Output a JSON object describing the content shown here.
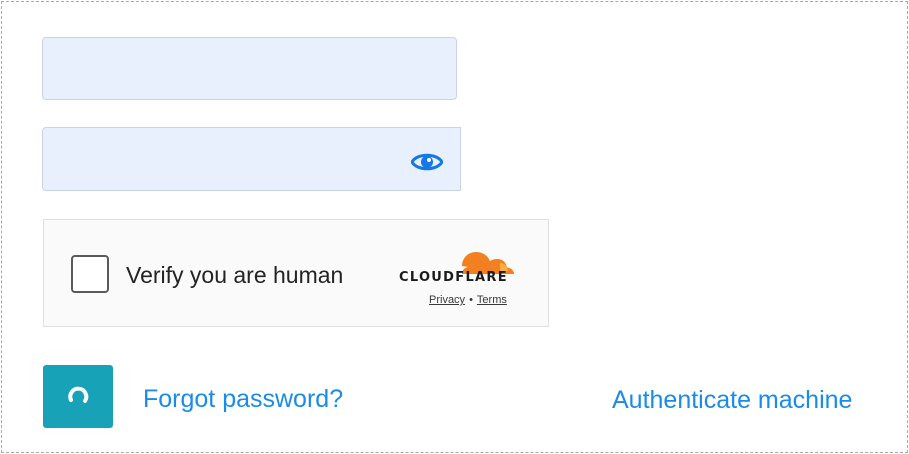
{
  "form": {
    "username": {
      "value": "",
      "placeholder": ""
    },
    "password": {
      "value": "",
      "placeholder": ""
    },
    "password_toggle_icon": "eye-icon"
  },
  "captcha": {
    "label": "Verify you are human",
    "brand": "CLOUDFLARE",
    "privacy_label": "Privacy",
    "separator": "•",
    "terms_label": "Terms",
    "logo_color": "#f38020",
    "checked": false
  },
  "actions": {
    "submit_icon": "loading-spinner-icon",
    "submit_color": "#17a2b8",
    "forgot_password": "Forgot password?",
    "authenticate_machine": "Authenticate machine",
    "link_color": "#1a8ce8"
  }
}
